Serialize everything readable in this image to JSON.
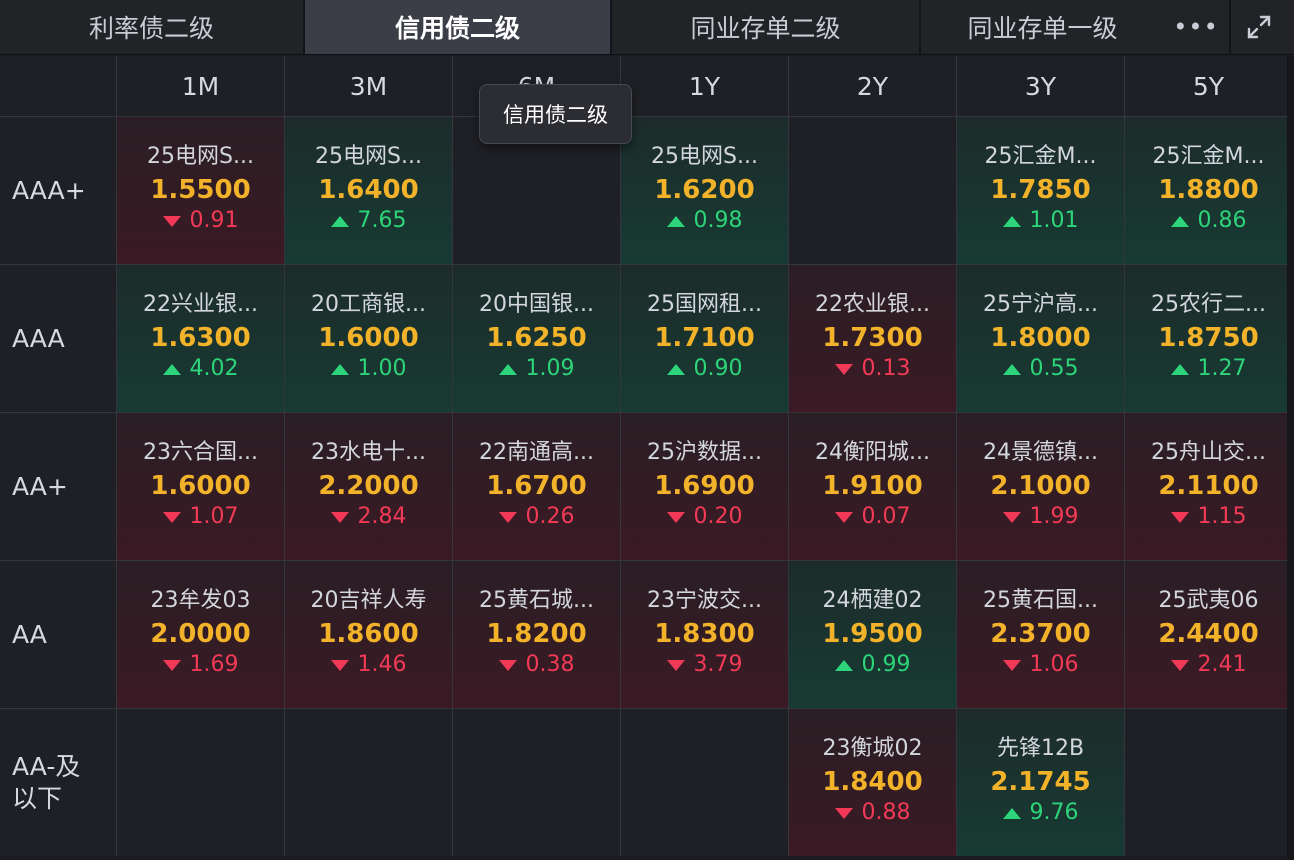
{
  "tabs": [
    {
      "label": "利率债二级",
      "active": false
    },
    {
      "label": "信用债二级",
      "active": true
    },
    {
      "label": "同业存单二级",
      "active": false
    },
    {
      "label": "同业存单一级",
      "active": false
    }
  ],
  "more_icon": "ellipsis-icon",
  "more_glyph": "•••",
  "expand_icon": "expand-icon",
  "tooltip": "信用债二级",
  "columns": [
    "1M",
    "3M",
    "6M",
    "1Y",
    "2Y",
    "3Y",
    "5Y"
  ],
  "rows": [
    {
      "label": "AAA+",
      "cells": [
        {
          "name": "25电网S...",
          "yield": "1.5500",
          "change": "0.91",
          "dir": "down"
        },
        {
          "name": "25电网S...",
          "yield": "1.6400",
          "change": "7.65",
          "dir": "up"
        },
        null,
        {
          "name": "25电网S...",
          "yield": "1.6200",
          "change": "0.98",
          "dir": "up"
        },
        null,
        {
          "name": "25汇金M...",
          "yield": "1.7850",
          "change": "1.01",
          "dir": "up"
        },
        {
          "name": "25汇金M...",
          "yield": "1.8800",
          "change": "0.86",
          "dir": "up"
        }
      ]
    },
    {
      "label": "AAA",
      "cells": [
        {
          "name": "22兴业银...",
          "yield": "1.6300",
          "change": "4.02",
          "dir": "up"
        },
        {
          "name": "20工商银...",
          "yield": "1.6000",
          "change": "1.00",
          "dir": "up"
        },
        {
          "name": "20中国银...",
          "yield": "1.6250",
          "change": "1.09",
          "dir": "up"
        },
        {
          "name": "25国网租...",
          "yield": "1.7100",
          "change": "0.90",
          "dir": "up"
        },
        {
          "name": "22农业银...",
          "yield": "1.7300",
          "change": "0.13",
          "dir": "down"
        },
        {
          "name": "25宁沪高...",
          "yield": "1.8000",
          "change": "0.55",
          "dir": "up"
        },
        {
          "name": "25农行二...",
          "yield": "1.8750",
          "change": "1.27",
          "dir": "up"
        }
      ]
    },
    {
      "label": "AA+",
      "cells": [
        {
          "name": "23六合国...",
          "yield": "1.6000",
          "change": "1.07",
          "dir": "down"
        },
        {
          "name": "23水电十...",
          "yield": "2.2000",
          "change": "2.84",
          "dir": "down"
        },
        {
          "name": "22南通高...",
          "yield": "1.6700",
          "change": "0.26",
          "dir": "down"
        },
        {
          "name": "25沪数据...",
          "yield": "1.6900",
          "change": "0.20",
          "dir": "down"
        },
        {
          "name": "24衡阳城...",
          "yield": "1.9100",
          "change": "0.07",
          "dir": "down"
        },
        {
          "name": "24景德镇...",
          "yield": "2.1000",
          "change": "1.99",
          "dir": "down"
        },
        {
          "name": "25舟山交...",
          "yield": "2.1100",
          "change": "1.15",
          "dir": "down"
        }
      ]
    },
    {
      "label": "AA",
      "cells": [
        {
          "name": "23牟发03",
          "yield": "2.0000",
          "change": "1.69",
          "dir": "down"
        },
        {
          "name": "20吉祥人寿",
          "yield": "1.8600",
          "change": "1.46",
          "dir": "down"
        },
        {
          "name": "25黄石城...",
          "yield": "1.8200",
          "change": "0.38",
          "dir": "down"
        },
        {
          "name": "23宁波交...",
          "yield": "1.8300",
          "change": "3.79",
          "dir": "down"
        },
        {
          "name": "24栖建02",
          "yield": "1.9500",
          "change": "0.99",
          "dir": "up"
        },
        {
          "name": "25黄石国...",
          "yield": "2.3700",
          "change": "1.06",
          "dir": "down"
        },
        {
          "name": "25武夷06",
          "yield": "2.4400",
          "change": "2.41",
          "dir": "down"
        }
      ]
    },
    {
      "label": "AA-及\n以下",
      "cells": [
        null,
        null,
        null,
        null,
        {
          "name": "23衡城02",
          "yield": "1.8400",
          "change": "0.88",
          "dir": "down"
        },
        {
          "name": "先锋12B",
          "yield": "2.1745",
          "change": "9.76",
          "dir": "up"
        },
        null
      ]
    }
  ],
  "colors": {
    "up": "#2ed47a",
    "down": "#f23a57",
    "yield": "#f2b32a",
    "active_tab": "#3b3d47"
  }
}
